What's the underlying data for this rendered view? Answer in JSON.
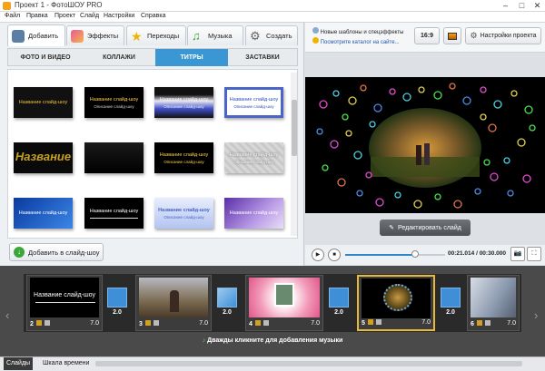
{
  "window": {
    "title": "Проект 1 - ФотоШОУ PRO",
    "minimize": "–",
    "maximize": "□",
    "close": "✕"
  },
  "menu": [
    "Файл",
    "Правка",
    "Проект",
    "Слайд",
    "Настройки",
    "Справка"
  ],
  "main_tabs": [
    {
      "label": "Добавить",
      "icon": "add-photo-icon",
      "active": true
    },
    {
      "label": "Эффекты",
      "icon": "effects-icon"
    },
    {
      "label": "Переходы",
      "icon": "star-icon"
    },
    {
      "label": "Музыка",
      "icon": "music-note-icon"
    },
    {
      "label": "Создать",
      "icon": "film-reel-icon"
    }
  ],
  "sub_tabs": [
    {
      "label": "ФОТО И ВИДЕО"
    },
    {
      "label": "КОЛЛАЖИ"
    },
    {
      "label": "ТИТРЫ",
      "active": true
    },
    {
      "label": "ЗАСТАВКИ"
    }
  ],
  "title_templates": [
    {
      "text": "Название слайд-шоу",
      "sub": ""
    },
    {
      "text": "Название слайд-шоу",
      "sub": "Описание слайд-шоу"
    },
    {
      "text": "Название слайд-шоу",
      "sub": "Описание слайд-шоу"
    },
    {
      "text": "Название слайд-шоу",
      "sub": "Описание слайд-шоу"
    },
    {
      "text": "Название",
      "sub": ""
    },
    {
      "text": "",
      "sub": ""
    },
    {
      "text": "Название слайд-шоу",
      "sub": "Описание слайд-шоу"
    },
    {
      "text": "Название слайд-шоу",
      "sub": "Описание слайд-шоу"
    },
    {
      "text": "Название слайд-шоу",
      "sub": ""
    },
    {
      "text": "Название слайд-шоу",
      "sub": ""
    },
    {
      "text": "Название слайд-шоу",
      "sub": "Описание слайд-шоу"
    },
    {
      "text": "Название слайд-шоу",
      "sub": ""
    }
  ],
  "add_to_show_label": "Добавить в слайд-шоу",
  "info": {
    "news": "Новые шаблоны и спецэффекты",
    "catalog": "Посмотрите каталог на сайте..."
  },
  "aspect_label": "16:9",
  "project_settings_label": "Настройки проекта",
  "edit_slide_label": "Редактировать слайд",
  "player": {
    "time": "00:21.014 / 00:30.000",
    "progress": 0.7
  },
  "slides": [
    {
      "num": "2",
      "dur": "7.0",
      "caption": "Название слайд-шоу"
    },
    {
      "num": "3",
      "dur": "7.0",
      "caption": ""
    },
    {
      "num": "4",
      "dur": "7.0",
      "caption": ""
    },
    {
      "num": "5",
      "dur": "7.0",
      "caption": "",
      "selected": true
    },
    {
      "num": "6",
      "dur": "7.0",
      "caption": ""
    }
  ],
  "transitions": [
    "2.0",
    "2.0",
    "2.0",
    "2.0"
  ],
  "music_hint": "Дважды кликните для добавления музыки",
  "bottom_tabs": [
    {
      "label": "Слайды",
      "active": true
    },
    {
      "label": "Шкала времени"
    }
  ],
  "colors": {
    "accent": "#3b97d3",
    "timeline_bg": "#4a4a4a",
    "selected_frame": "#e6b93a"
  }
}
